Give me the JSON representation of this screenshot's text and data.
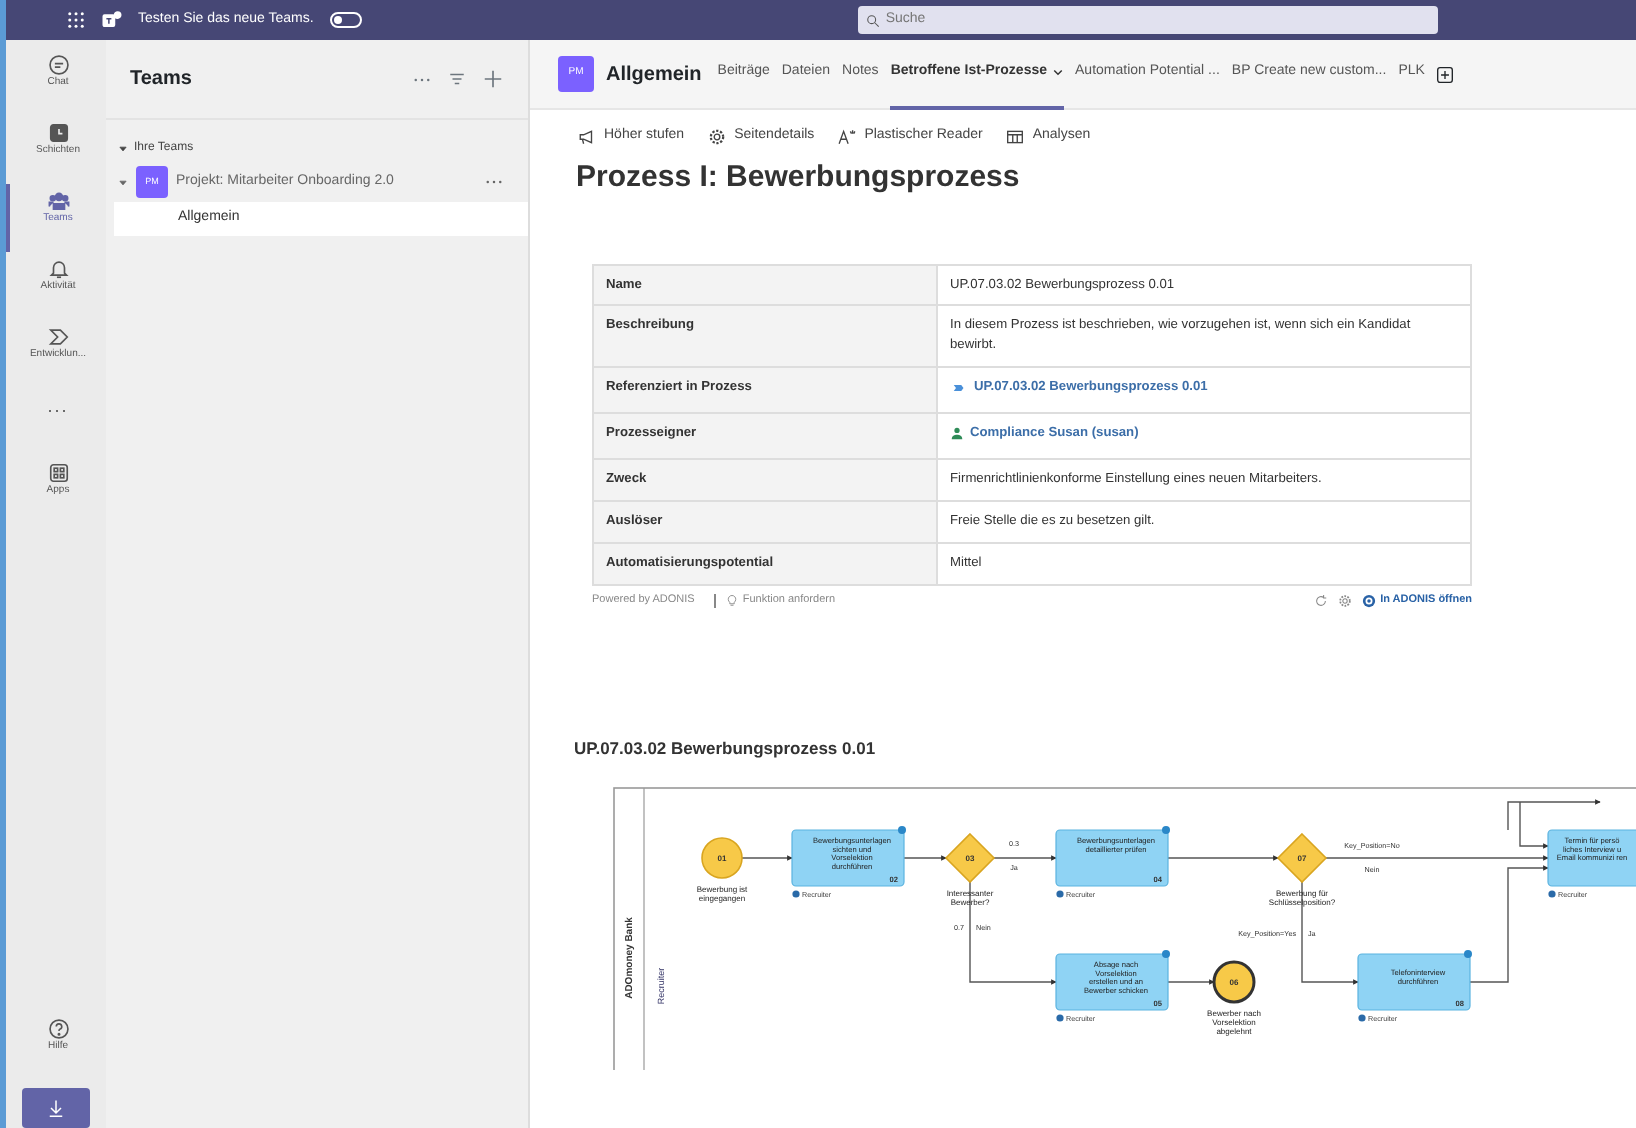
{
  "top_bar": {
    "promo": "Testen Sie das neue Teams.",
    "new_teams_toggle": {
      "on": false
    },
    "search": {
      "placeholder": "Suche"
    }
  },
  "app_rail": {
    "items": [
      {
        "label": "Chat",
        "selected": false
      },
      {
        "label": "Schichten",
        "selected": false
      },
      {
        "label": "Teams",
        "selected": true
      },
      {
        "label": "Aktivität",
        "selected": false
      },
      {
        "label": "Entwicklun...",
        "selected": false
      },
      {
        "label": "...",
        "selected": false
      },
      {
        "label": "Apps",
        "selected": false
      }
    ],
    "bottom": [
      {
        "label": "Hilfe",
        "kind": "help"
      },
      {
        "kind": "download"
      }
    ]
  },
  "teams_panel": {
    "title": "Teams",
    "section": "Ihre Teams",
    "teams": [
      {
        "avatar": "PM",
        "name": "Projekt: Mitarbeiter Onboarding 2.0",
        "expanded": true,
        "channels": [
          {
            "name": "Allgemein",
            "selected": true
          }
        ]
      }
    ]
  },
  "channel_header": {
    "avatar": "PM",
    "channel": "Allgemein",
    "tabs": [
      {
        "label": "Beiträge",
        "selected": false,
        "dropdown": false
      },
      {
        "label": "Dateien",
        "selected": false,
        "dropdown": false
      },
      {
        "label": "Notes",
        "selected": false,
        "dropdown": false
      },
      {
        "label": "Betroffene Ist-Prozesse",
        "selected": true,
        "dropdown": true
      },
      {
        "label": "Automation Potential ...",
        "selected": false,
        "dropdown": false
      },
      {
        "label": "BP Create new custom...",
        "selected": false,
        "dropdown": false
      },
      {
        "label": "PLK",
        "selected": false,
        "dropdown": false
      }
    ]
  },
  "page_toolbar": [
    {
      "label": "Höher stufen"
    },
    {
      "label": "Seitendetails"
    },
    {
      "label": "Plastischer Reader"
    },
    {
      "label": "Analysen"
    }
  ],
  "page_title": "Prozess I: Bewerbungsprozess",
  "details_table": {
    "rows": [
      {
        "label": "Name",
        "value": "UP.07.03.02 Bewerbungsprozess 0.01",
        "kind": "text"
      },
      {
        "label": "Beschreibung",
        "value": "In diesem Prozess ist beschrieben, wie vorzugehen ist, wenn sich ein Kandidat bewirbt.",
        "kind": "text"
      },
      {
        "label": "Referenziert in Prozess",
        "value": "UP.07.03.02 Bewerbungsprozess 0.01",
        "kind": "process-link"
      },
      {
        "label": "Prozesseigner",
        "value": "Compliance Susan (susan)",
        "kind": "person-link"
      },
      {
        "label": "Zweck",
        "value": "Firmenrichtlinienkonforme Einstellung eines neuen Mitarbeiters.",
        "kind": "text"
      },
      {
        "label": "Auslöser",
        "value": "Freie Stelle die es zu besetzen gilt.",
        "kind": "text"
      },
      {
        "label": "Automatisierungspotential",
        "value": "Mittel",
        "kind": "text"
      }
    ],
    "footer": {
      "powered_by": "Powered by ADONIS",
      "request": "Funktion anfordern",
      "open": "In ADONIS öffnen"
    }
  },
  "diagram": {
    "title": "UP.07.03.02 Bewerbungsprozess 0.01",
    "pool": "ADOmoney Bank",
    "lane": "Recruiter",
    "nodes": [
      {
        "kind": "start",
        "number": "01",
        "label": "Bewerbung ist eingegangen"
      },
      {
        "kind": "task",
        "number": "02",
        "label": "Bewerbungsunterlagen sichten und Vorselektion durchführen",
        "role": "Recruiter"
      },
      {
        "kind": "gateway",
        "number": "03",
        "label": "Interessanter Bewerber?"
      },
      {
        "kind": "task",
        "number": "04",
        "label": "Bewerbungsunterlagen detaillierter prüfen",
        "role": "Recruiter"
      },
      {
        "kind": "task",
        "number": "05",
        "label": "Absage nach Vorselektion erstellen und an Bewerber schicken",
        "role": "Recruiter"
      },
      {
        "kind": "end",
        "number": "06",
        "label": "Bewerber nach Vorselektion abgelehnt"
      },
      {
        "kind": "gateway",
        "number": "07",
        "label": "Bewerbung für Schlüsselposition?"
      },
      {
        "kind": "task",
        "number": "08",
        "label": "Telefoninterview durchführen",
        "role": "Recruiter"
      },
      {
        "kind": "task",
        "label": "Termin für persö liches Interview u Email kommunizi ren",
        "role": "Recruiter"
      }
    ],
    "edge_labels": [
      "0.3",
      "Ja",
      "0.7",
      "Nein",
      "Key_Position=No",
      "Nein",
      "Key_Position=Yes",
      "Ja"
    ]
  }
}
